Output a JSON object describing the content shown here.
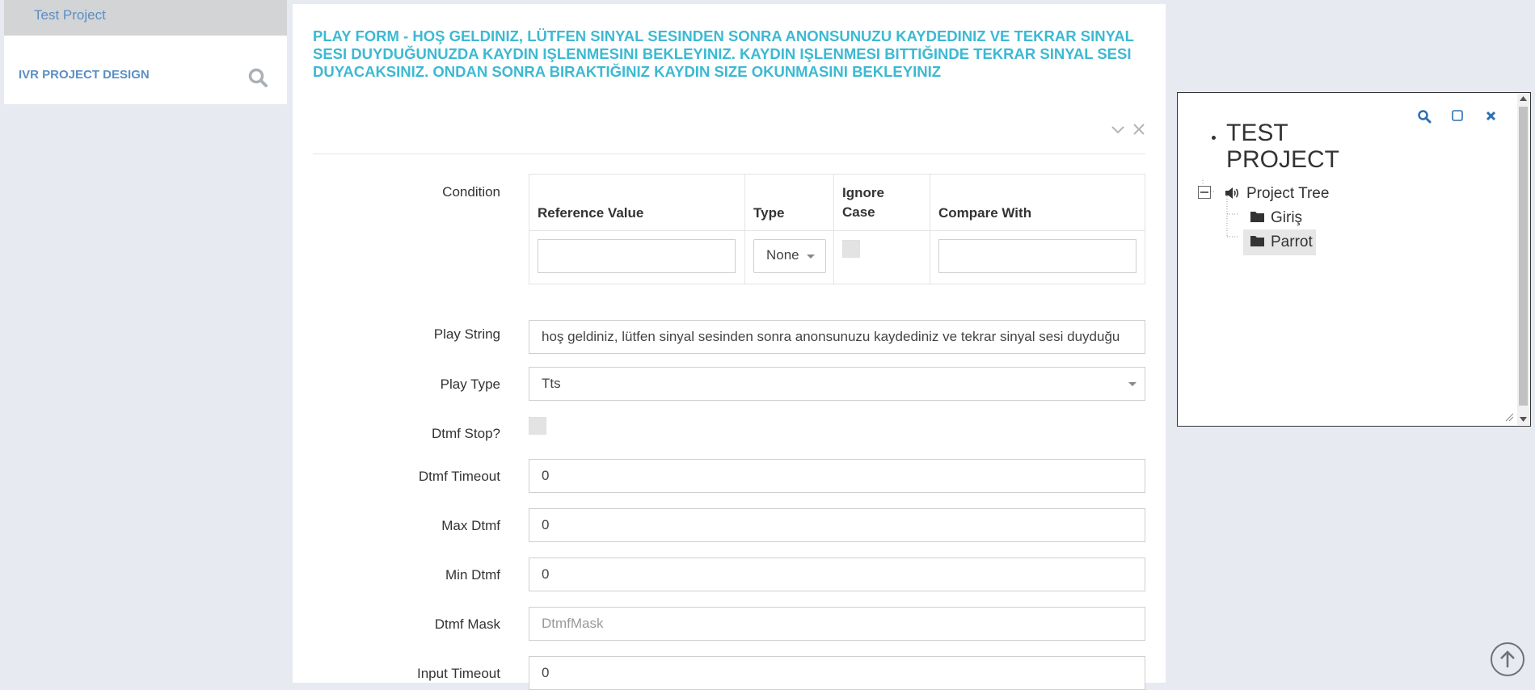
{
  "sidebar": {
    "project_link": "Test Project",
    "section_title": "IVR PROJECT DESIGN",
    "search_icon": "search-icon"
  },
  "form": {
    "title": "PLAY FORM - HOŞ GELDINIZ, LÜTFEN SINYAL SESINDEN SONRA ANONSUNUZU KAYDEDINIZ VE TEKRAR SINYAL SESI DUYDUĞUNUZDA KAYDIN IŞLENMESINI BEKLEYINIZ. KAYDIN IŞLENMESI BITTIĞINDE TEKRAR SINYAL SESI DUYACAKSINIZ. ONDAN SONRA BIRAKTIĞINIZ KAYDIN SIZE OKUNMASINI BEKLEYINIZ",
    "condition": {
      "label": "Condition",
      "headers": {
        "reference_value": "Reference Value",
        "type": "Type",
        "ignore_case_1": "Ignore",
        "ignore_case_2": "Case",
        "compare_with": "Compare With"
      },
      "type_selected": "None",
      "ignore_case_checked": false
    },
    "play_string": {
      "label": "Play String",
      "value": "hoş geldiniz, lütfen sinyal sesinden sonra anonsunuzu kaydediniz ve tekrar sinyal sesi duyduğu"
    },
    "play_type": {
      "label": "Play Type",
      "value": "Tts"
    },
    "dtmf_stop": {
      "label": "Dtmf Stop?",
      "checked": false
    },
    "dtmf_timeout": {
      "label": "Dtmf Timeout",
      "value": "0"
    },
    "max_dtmf": {
      "label": "Max Dtmf",
      "value": "0"
    },
    "min_dtmf": {
      "label": "Min Dtmf",
      "value": "0"
    },
    "dtmf_mask": {
      "label": "Dtmf Mask",
      "placeholder": "DtmfMask"
    },
    "input_timeout": {
      "label": "Input Timeout",
      "value": "0"
    }
  },
  "tree": {
    "title_line1": "TEST",
    "title_line2": "PROJECT",
    "root": "Project Tree",
    "children": [
      "Giriş",
      "Parrot"
    ],
    "selected": "Parrot"
  },
  "colors": {
    "title": "#3cb9d3",
    "link": "#5b8fc4",
    "background": "#e7eaf1",
    "tree_icon_blue": "#2b6fb3"
  }
}
